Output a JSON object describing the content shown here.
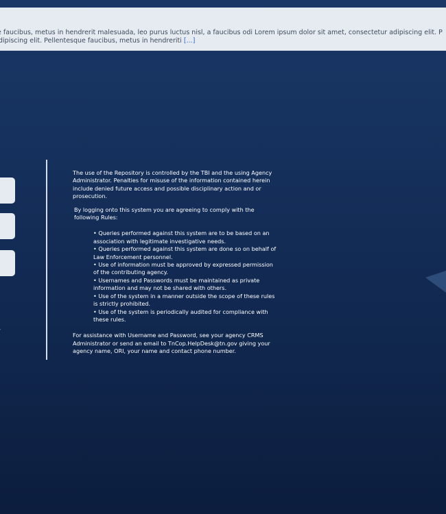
{
  "banner": {
    "line1": "e faucibus, metus in hendrerit malesuada, leo purus luctus nisl, a faucibus odi Lorem ipsum dolor sit amet, consectetur adipiscing elit. P",
    "line2": "dipiscing elit. Pellentesque faucibus, metus in hendreriti",
    "more_link": "[...]"
  },
  "notice": {
    "usage": "The use of the Repository is controlled by the TBI and the using Agency Administrator. Penalties for misuse of the information contained herein include denied future access and possible disciplinary action and or prosecution.",
    "agree": "By logging onto this system you are agreeing to comply with the following Rules:",
    "rules": [
      "Queries performed against this system are to be based on an association with legitimate investigative needs.",
      "Queries performed against this system are done so on behalf of Law Enforcement personnel.",
      "Use of information must be approved by expressed permission of the contributing agency.",
      "Usernames and Passwords must be maintained as private information and may not be shared with others.",
      "Use of the system in a manner outside the scope of these rules is strictly prohibited.",
      "Use of the system is periodically audited for compliance with these rules."
    ],
    "assistance": "For assistance with Username and Password, see your agency CRMS Administrator or send an email to TnCop.HelpDesk@tn.gov giving your agency name, ORI, your name and contact phone number."
  },
  "side_mark": "-",
  "colors": {
    "background_top": "#1a3766",
    "background_bottom": "#0c1d3d",
    "banner_bg": "#e6ebf2",
    "link": "#2e6cc0"
  }
}
